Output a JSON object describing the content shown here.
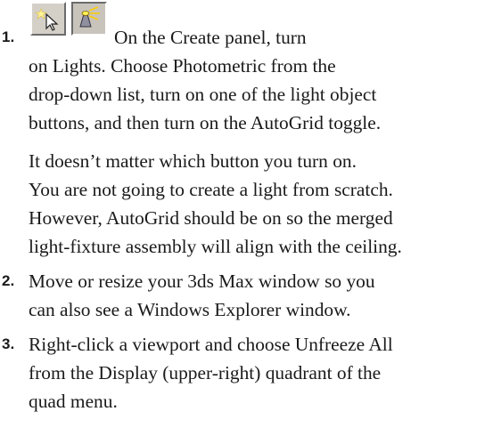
{
  "steps": [
    {
      "number": "1.",
      "lines": [
        "On the Create panel, turn",
        "on Lights.  Choose Photometric from the",
        "drop-down list, turn on one of the light object",
        "buttons, and then turn on the AutoGrid toggle."
      ],
      "icons": [
        "create-panel-create-icon",
        "lights-icon"
      ],
      "note_lines": [
        "It doesn’t matter which button you turn on.",
        "You are not going to create a light from scratch.",
        "However, AutoGrid should be on so the merged",
        "light-fixture assembly will align with the ceiling."
      ]
    },
    {
      "number": "2.",
      "lines": [
        "Move or resize your 3ds Max window so you",
        "can also see a Windows Explorer window."
      ]
    },
    {
      "number": "3.",
      "lines": [
        "Right-click a viewport and choose Unfreeze All",
        "from the Display (upper-right) quadrant of the",
        "quad menu."
      ]
    }
  ]
}
